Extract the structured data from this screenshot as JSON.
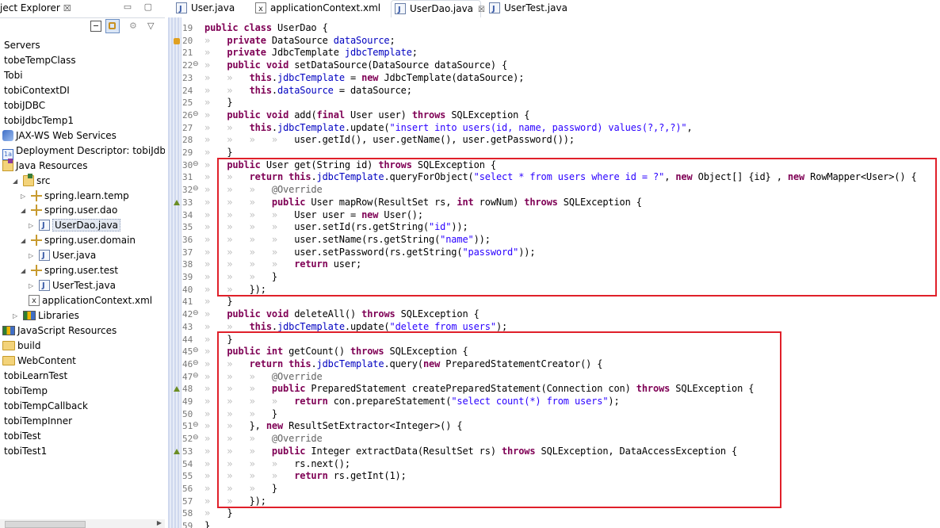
{
  "explorer": {
    "title": "ject Explorer",
    "close": "☒",
    "minmax": "▭ ▢",
    "menu": "▽",
    "focus": "⚙",
    "items": [
      {
        "label": "Servers",
        "icon": "",
        "indent": 0,
        "twisty": "",
        "y": 0
      },
      {
        "label": "tobeTempClass",
        "icon": "",
        "indent": 0,
        "twisty": ""
      },
      {
        "label": "Tobi",
        "icon": "",
        "indent": 0,
        "twisty": ""
      },
      {
        "label": "tobiContextDI",
        "icon": "",
        "indent": 0,
        "twisty": ""
      },
      {
        "label": "tobiJDBC",
        "icon": "",
        "indent": 0,
        "twisty": ""
      },
      {
        "label": "tobiJdbcTemp1",
        "icon": "",
        "indent": 0,
        "twisty": ""
      },
      {
        "label": "JAX-WS Web Services",
        "icon": "ws",
        "indent": 0,
        "twisty": ""
      },
      {
        "label": "Deployment Descriptor: tobiJdbc",
        "icon": "dd",
        "indent": 0,
        "twisty": ""
      },
      {
        "label": "Java Resources",
        "icon": "res",
        "indent": 0,
        "twisty": ""
      },
      {
        "label": "src",
        "icon": "src",
        "indent": 1,
        "twisty": "◢"
      },
      {
        "label": "spring.learn.temp",
        "icon": "pkg",
        "indent": 2,
        "twisty": "▷"
      },
      {
        "label": "spring.user.dao",
        "icon": "pkg",
        "indent": 2,
        "twisty": "◢"
      },
      {
        "label": "UserDao.java",
        "icon": "java",
        "indent": 3,
        "twisty": "▷",
        "selected": true
      },
      {
        "label": "spring.user.domain",
        "icon": "pkg",
        "indent": 2,
        "twisty": "◢"
      },
      {
        "label": "User.java",
        "icon": "java",
        "indent": 3,
        "twisty": "▷"
      },
      {
        "label": "spring.user.test",
        "icon": "pkg",
        "indent": 2,
        "twisty": "◢"
      },
      {
        "label": "UserTest.java",
        "icon": "java",
        "indent": 3,
        "twisty": "▷"
      },
      {
        "label": "applicationContext.xml",
        "icon": "xml",
        "indent": 3,
        "twisty": ""
      },
      {
        "label": "Libraries",
        "icon": "lib",
        "indent": 1,
        "twisty": "▷"
      },
      {
        "label": "JavaScript Resources",
        "icon": "lib",
        "indent": 0,
        "twisty": ""
      },
      {
        "label": "build",
        "icon": "folder",
        "indent": 0,
        "twisty": ""
      },
      {
        "label": "WebContent",
        "icon": "folder",
        "indent": 0,
        "twisty": ""
      },
      {
        "label": "tobiLearnTest",
        "icon": "",
        "indent": 0,
        "twisty": ""
      },
      {
        "label": "tobiTemp",
        "icon": "",
        "indent": 0,
        "twisty": ""
      },
      {
        "label": "tobiTempCallback",
        "icon": "",
        "indent": 0,
        "twisty": ""
      },
      {
        "label": "tobiTempInner",
        "icon": "",
        "indent": 0,
        "twisty": ""
      },
      {
        "label": "tobiTest",
        "icon": "",
        "indent": 0,
        "twisty": ""
      },
      {
        "label": "tobiTest1",
        "icon": "",
        "indent": 0,
        "twisty": ""
      }
    ]
  },
  "tabs": [
    {
      "label": "User.java",
      "icon": "java",
      "active": false
    },
    {
      "label": "applicationContext.xml",
      "icon": "xml",
      "active": false
    },
    {
      "label": "UserDao.java",
      "icon": "java",
      "active": true,
      "close": "☒"
    },
    {
      "label": "UserTest.java",
      "icon": "java",
      "active": false
    }
  ],
  "code": [
    {
      "n": "19",
      "t": "public class UserDao {"
    },
    {
      "n": "20",
      "t": "    private DataSource dataSource;",
      "mark": "impl"
    },
    {
      "n": "21",
      "t": "    private JdbcTemplate jdbcTemplate;"
    },
    {
      "n": "22",
      "t": "    public void setDataSource(DataSource dataSource) {",
      "fold": true
    },
    {
      "n": "23",
      "t": "        this.jdbcTemplate = new JdbcTemplate(dataSource);"
    },
    {
      "n": "24",
      "t": "        this.dataSource = dataSource;"
    },
    {
      "n": "25",
      "t": "    }"
    },
    {
      "n": "26",
      "t": "    public void add(final User user) throws SQLException {",
      "fold": true
    },
    {
      "n": "27",
      "t": "        this.jdbcTemplate.update(\"insert into users(id, name, password) values(?,?,?)\","
    },
    {
      "n": "28",
      "t": "                user.getId(), user.getName(), user.getPassword());"
    },
    {
      "n": "29",
      "t": "    }"
    },
    {
      "n": "30",
      "t": "    public User get(String id) throws SQLException {",
      "fold": true
    },
    {
      "n": "31",
      "t": "        return this.jdbcTemplate.queryForObject(\"select * from users where id = ?\", new Object[] {id} , new RowMapper<User>() {"
    },
    {
      "n": "32",
      "t": "            @Override",
      "fold": true
    },
    {
      "n": "33",
      "t": "            public User mapRow(ResultSet rs, int rowNum) throws SQLException {",
      "mark": "override"
    },
    {
      "n": "34",
      "t": "                User user = new User();"
    },
    {
      "n": "35",
      "t": "                user.setId(rs.getString(\"id\"));"
    },
    {
      "n": "36",
      "t": "                user.setName(rs.getString(\"name\"));"
    },
    {
      "n": "37",
      "t": "                user.setPassword(rs.getString(\"password\"));"
    },
    {
      "n": "38",
      "t": "                return user;"
    },
    {
      "n": "39",
      "t": "            }"
    },
    {
      "n": "40",
      "t": "        });"
    },
    {
      "n": "41",
      "t": "    }"
    },
    {
      "n": "42",
      "t": "    public void deleteAll() throws SQLException {",
      "fold": true
    },
    {
      "n": "43",
      "t": "        this.jdbcTemplate.update(\"delete from users\");"
    },
    {
      "n": "44",
      "t": "    }"
    },
    {
      "n": "45",
      "t": "    public int getCount() throws SQLException {",
      "fold": true
    },
    {
      "n": "46",
      "t": "        return this.jdbcTemplate.query(new PreparedStatementCreator() {",
      "fold": true
    },
    {
      "n": "47",
      "t": "            @Override",
      "fold": true
    },
    {
      "n": "48",
      "t": "            public PreparedStatement createPreparedStatement(Connection con) throws SQLException {",
      "mark": "override"
    },
    {
      "n": "49",
      "t": "                return con.prepareStatement(\"select count(*) from users\");"
    },
    {
      "n": "50",
      "t": "            }"
    },
    {
      "n": "51",
      "t": "        }, new ResultSetExtractor<Integer>() {",
      "fold": true
    },
    {
      "n": "52",
      "t": "            @Override",
      "fold": true
    },
    {
      "n": "53",
      "t": "            public Integer extractData(ResultSet rs) throws SQLException, DataAccessException {",
      "mark": "override"
    },
    {
      "n": "54",
      "t": "                rs.next();"
    },
    {
      "n": "55",
      "t": "                return rs.getInt(1);"
    },
    {
      "n": "56",
      "t": "            }"
    },
    {
      "n": "57",
      "t": "        });"
    },
    {
      "n": "58",
      "t": "    }"
    },
    {
      "n": "59",
      "t": "}"
    }
  ],
  "colors": {
    "keyword": "#7f0055",
    "field": "#0000c0",
    "string": "#2a00ff",
    "annotation": "#646464",
    "highlight_box": "#e0202a"
  }
}
